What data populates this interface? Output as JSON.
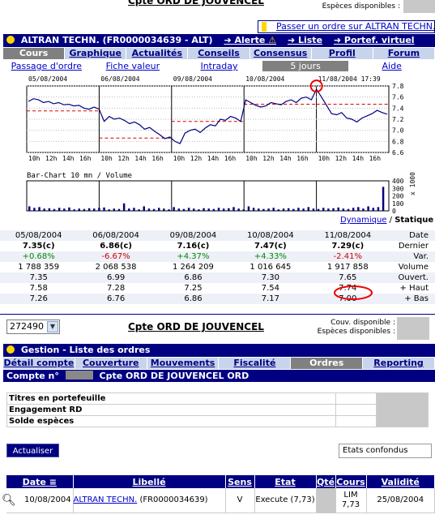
{
  "header": {
    "account_title": "Cpte ORD DE JOUVENCEL",
    "cash_label": "Espèces disponibles :"
  },
  "order_link": "Passer un ordre sur ALTRAN TECHN.",
  "stock_bar": {
    "title": "ALTRAN TECHN. (FR0000034639 - ALT)",
    "links": [
      "Alerte",
      "Liste",
      "Portef. virtuel"
    ]
  },
  "tabs": [
    "Cours",
    "Graphique",
    "Actualités",
    "Conseils",
    "Consensus",
    "Profil",
    "Forum"
  ],
  "active_tab": 0,
  "subtabs": [
    "Passage d'ordre",
    "Fiche valeur",
    "Intraday",
    "5 jours",
    "Aide"
  ],
  "active_subtab": 3,
  "chart_data": [
    {
      "type": "line",
      "title": "",
      "x": [
        "05/08/2004",
        "06/08/2004",
        "09/08/2004",
        "10/08/2004",
        "11/08/2004 17:39"
      ],
      "x_ticks": [
        "10h",
        "12h",
        "14h",
        "16h"
      ],
      "y_ticks": [
        "7.8",
        "7.6",
        "7.4",
        "7.2",
        "7.0",
        "6.8",
        "6.6"
      ],
      "ylim": [
        6.6,
        7.8
      ],
      "series": [
        {
          "values": [
            7.52,
            7.57,
            7.55,
            7.5,
            7.52,
            7.48,
            7.5,
            7.46,
            7.47,
            7.44,
            7.45,
            7.4,
            7.38,
            7.42,
            7.38,
            7.16,
            7.25,
            7.2,
            7.22,
            7.18,
            7.12,
            7.15,
            7.1,
            7.02,
            7.05,
            6.98,
            6.92,
            6.85,
            6.88,
            6.8,
            6.76,
            6.95,
            7.0,
            7.02,
            6.96,
            7.04,
            7.1,
            7.08,
            7.2,
            7.18,
            7.25,
            7.22,
            7.16,
            7.55,
            7.5,
            7.45,
            7.42,
            7.44,
            7.5,
            7.48,
            7.46,
            7.52,
            7.55,
            7.5,
            7.58,
            7.6,
            7.55,
            7.74,
            7.6,
            7.45,
            7.3,
            7.28,
            7.32,
            7.22,
            7.2,
            7.15,
            7.22,
            7.26,
            7.3,
            7.36,
            7.32,
            7.29
          ]
        }
      ],
      "reference_lines": [
        7.35,
        6.86,
        7.16,
        7.47
      ],
      "grid": true
    },
    {
      "type": "bar",
      "title": "Bar-Chart 10 mn / Volume",
      "ylabel": "x 1000",
      "y_ticks": [
        "400",
        "300",
        "200",
        "100",
        "0"
      ],
      "ylim": [
        0,
        400
      ],
      "values": [
        60,
        40,
        50,
        30,
        35,
        25,
        40,
        30,
        45,
        20,
        30,
        25,
        35,
        30,
        40,
        45,
        20,
        30,
        25,
        100,
        30,
        40,
        20,
        60,
        30,
        25,
        40,
        30,
        20,
        50,
        30,
        25,
        40,
        30,
        20,
        35,
        30,
        25,
        40,
        30,
        35,
        50,
        30,
        20,
        60,
        40,
        30,
        25,
        30,
        40,
        20,
        30,
        35,
        25,
        40,
        30,
        50,
        30,
        25,
        40,
        30,
        35,
        45,
        30,
        25,
        40,
        50,
        30,
        60,
        40,
        50,
        320
      ]
    }
  ],
  "view_links": {
    "dynamic": "Dynamique",
    "static": "Statique",
    "separator": "/"
  },
  "history": {
    "dates": [
      "05/08/2004",
      "06/08/2004",
      "09/08/2004",
      "10/08/2004",
      "11/08/2004"
    ],
    "label_date": "Date",
    "rows": [
      {
        "label": "Dernier",
        "values": [
          "7.35(c)",
          "6.86(c)",
          "7.16(c)",
          "7.47(c)",
          "7.29(c)"
        ]
      },
      {
        "label": "Var.",
        "values": [
          "+0.68%",
          "-6.67%",
          "+4.37%",
          "+4.33%",
          "-2.41%"
        ]
      },
      {
        "label": "Volume",
        "values": [
          "1 788 359",
          "2 068 538",
          "1 264 209",
          "1 016 645",
          "1 917 858"
        ]
      },
      {
        "label": "Ouvert.",
        "values": [
          "7.35",
          "6.99",
          "6.86",
          "7.30",
          "7.65"
        ]
      },
      {
        "label": "+ Haut",
        "values": [
          "7.58",
          "7.28",
          "7.25",
          "7.54",
          "7.74"
        ]
      },
      {
        "label": "+ Bas",
        "values": [
          "7.26",
          "6.76",
          "6.86",
          "7.17",
          "7.00"
        ]
      }
    ]
  },
  "account_select": {
    "value": "272490",
    "title": "Cpte ORD DE JOUVENCEL",
    "couv_label": "Couv. disponible :",
    "cash_label": "Espèces disponibles :"
  },
  "gestion": {
    "title": "Gestion - Liste des ordres",
    "tabs": [
      "Détail compte",
      "Couverture",
      "Mouvements",
      "Fiscalité",
      "Ordres",
      "Reporting"
    ],
    "active_tab": 4,
    "compte_label": "Compte n°",
    "compte_name": "Cpte ORD DE JOUVENCEL ORD"
  },
  "holdings": [
    "Titres en portefeuille",
    "Engagement RD",
    "Solde espèces"
  ],
  "actualiser_label": "Actualiser",
  "filter_value": "Etats confondus",
  "orders": {
    "headers": [
      "Date",
      "Libellé",
      "Sens",
      "Etat",
      "Qté",
      "Cours",
      "Validité"
    ],
    "rows": [
      {
        "date": "10/08/2004",
        "libelle_link": "ALTRAN TECHN.",
        "libelle_code": " (FR0000034639)",
        "sens": "V",
        "etat": "Execute (7,73)",
        "cours_type": "LIM",
        "cours_value": "7,73",
        "validite": "25/08/2004"
      }
    ]
  }
}
